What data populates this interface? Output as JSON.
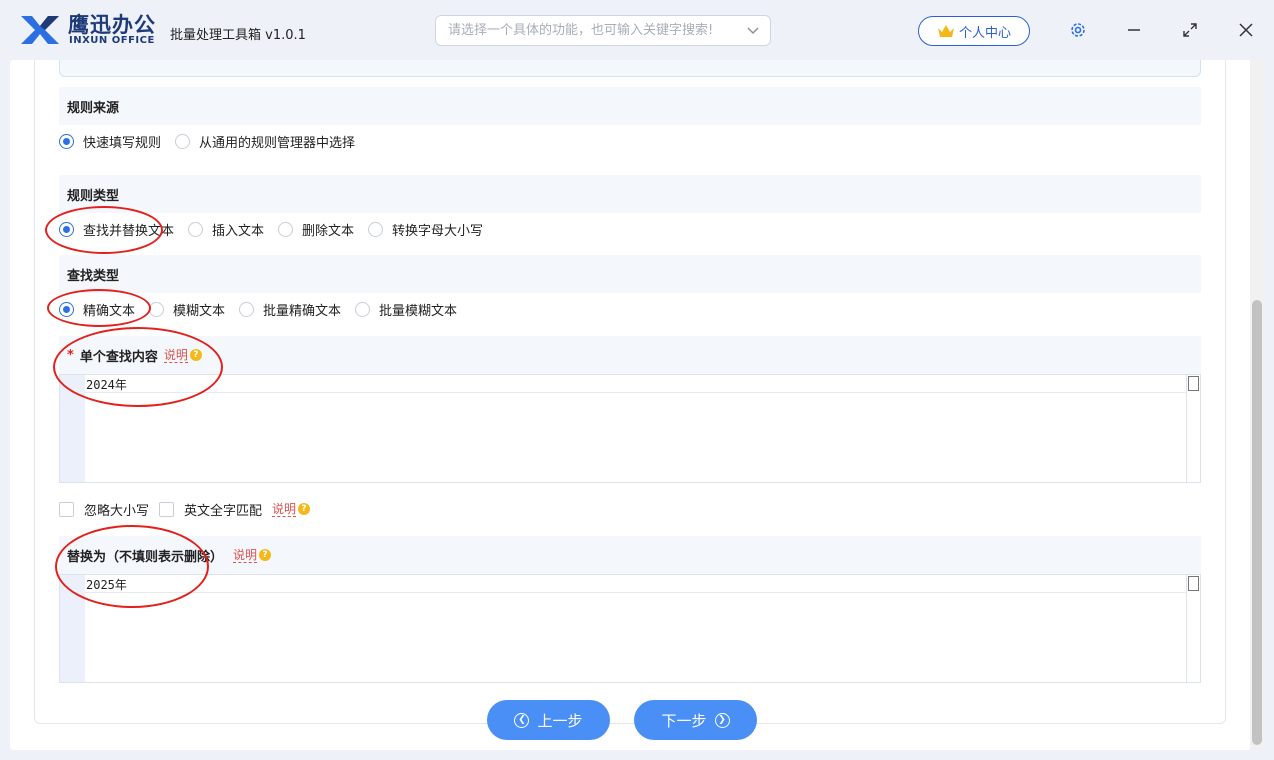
{
  "titlebar": {
    "brand_cn": "鹰迅办公",
    "brand_en": "INXUN OFFICE",
    "app_title": "批量处理工具箱 v1.0.1",
    "search_placeholder": "请选择一个具体的功能，也可输入关键字搜索!",
    "user_center_label": "个人中心",
    "icons": [
      "logo-icon",
      "chevron-down-icon",
      "crown-icon",
      "gear-icon",
      "minimize-icon",
      "maximize-icon",
      "close-icon"
    ]
  },
  "rule_source": {
    "title": "规则来源",
    "options": [
      {
        "label": "快速填写规则",
        "selected": true
      },
      {
        "label": "从通用的规则管理器中选择",
        "selected": false
      }
    ]
  },
  "rule_type": {
    "title": "规则类型",
    "options": [
      {
        "label": "查找并替换文本",
        "selected": true
      },
      {
        "label": "插入文本",
        "selected": false
      },
      {
        "label": "删除文本",
        "selected": false
      },
      {
        "label": "转换字母大小写",
        "selected": false
      }
    ]
  },
  "find_type": {
    "title": "查找类型",
    "options": [
      {
        "label": "精确文本",
        "selected": true
      },
      {
        "label": "模糊文本",
        "selected": false
      },
      {
        "label": "批量精确文本",
        "selected": false
      },
      {
        "label": "批量模糊文本",
        "selected": false
      }
    ]
  },
  "find_content": {
    "required_mark": "*",
    "title": "单个查找内容",
    "help": "说明",
    "value": "2024年"
  },
  "match_options": [
    {
      "label": "忽略大小写",
      "checked": false
    },
    {
      "label": "英文全字匹配",
      "checked": false
    }
  ],
  "match_help": "说明",
  "replace_with": {
    "title": "替换为（不填则表示删除）",
    "help": "说明",
    "value": "2025年"
  },
  "nav": {
    "prev_label": "上一步",
    "next_label": "下一步"
  },
  "colors": {
    "accent": "#4a8ff5",
    "radio_selected": "#2b6fe0",
    "annotation": "#e3201b",
    "brand": "#1e3a78"
  }
}
